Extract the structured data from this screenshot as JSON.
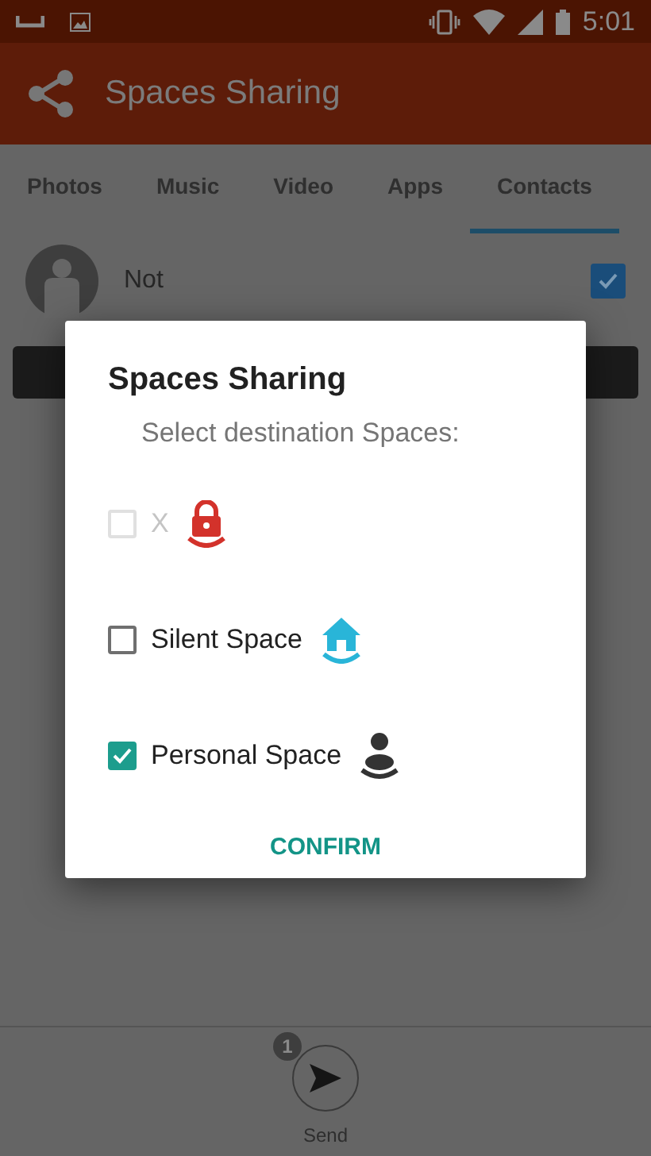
{
  "status_bar": {
    "time": "5:01"
  },
  "app_bar": {
    "title": "Spaces Sharing"
  },
  "tabs": [
    {
      "label": "Photos",
      "selected": false
    },
    {
      "label": "Music",
      "selected": false
    },
    {
      "label": "Video",
      "selected": false
    },
    {
      "label": "Apps",
      "selected": false
    },
    {
      "label": "Contacts",
      "selected": true
    }
  ],
  "contacts": [
    {
      "name": "Not",
      "checked": true
    }
  ],
  "dialog": {
    "title": "Spaces Sharing",
    "subtitle": "Select destination Spaces:",
    "options": [
      {
        "label": "X",
        "checked": false,
        "disabled": true,
        "kind": "lock"
      },
      {
        "label": "Silent Space",
        "checked": false,
        "disabled": false,
        "kind": "home"
      },
      {
        "label": "Personal Space",
        "checked": true,
        "disabled": false,
        "kind": "person"
      }
    ],
    "confirm": "CONFIRM"
  },
  "send_bar": {
    "badge": "1",
    "label": "Send"
  }
}
